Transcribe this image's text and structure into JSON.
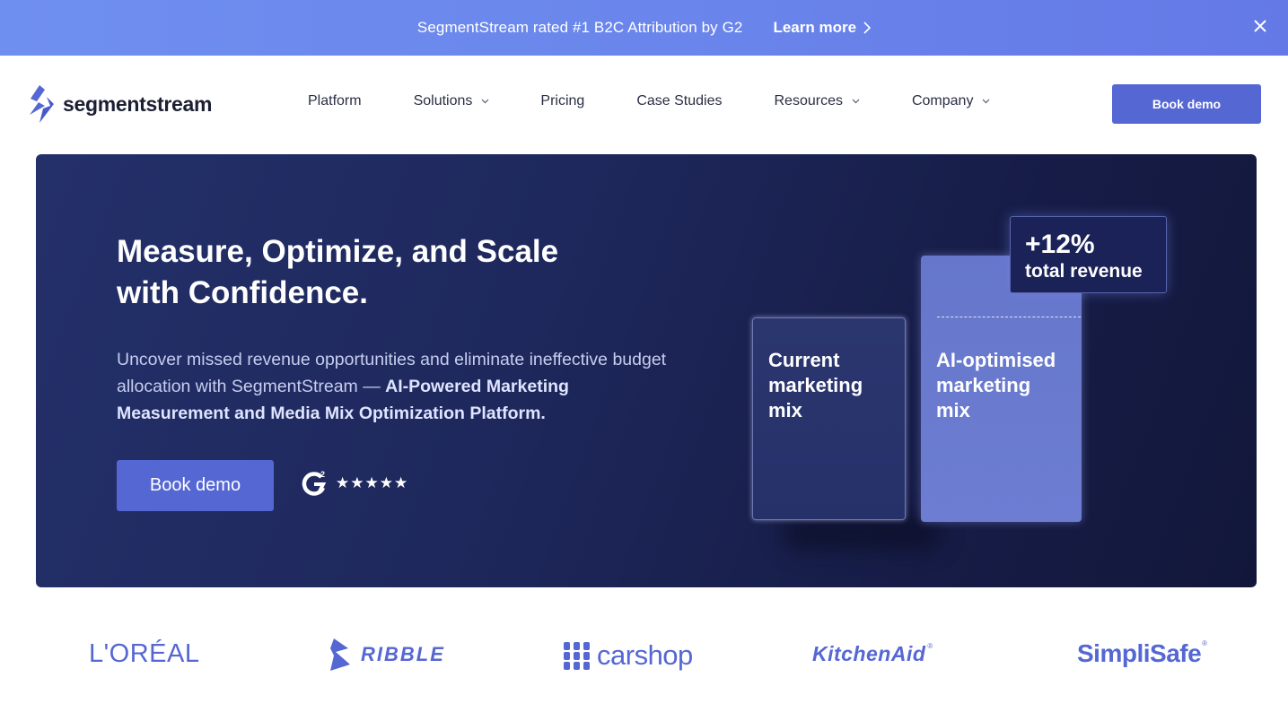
{
  "announcement": {
    "message": "SegmentStream rated #1 B2C Attribution by G2",
    "link_label": "Learn more"
  },
  "nav": {
    "brand": "segmentstream",
    "items": [
      {
        "label": "Platform",
        "dropdown": false
      },
      {
        "label": "Solutions",
        "dropdown": true
      },
      {
        "label": "Pricing",
        "dropdown": false
      },
      {
        "label": "Case Studies",
        "dropdown": false
      },
      {
        "label": "Resources",
        "dropdown": true
      },
      {
        "label": "Company",
        "dropdown": true
      }
    ],
    "cta_label": "Book demo"
  },
  "hero": {
    "title_line1": "Measure, Optimize, and Scale",
    "title_line2": "with Confidence.",
    "subtitle_plain": "Uncover missed revenue opportunities and eliminate ineffective budget allocation with SegmentStream — ",
    "subtitle_bold": "AI-Powered Marketing Measurement and Media Mix Optimization Platform.",
    "cta_label": "Book demo",
    "rating_stars": "★★★★★",
    "rating_icon": "g2-icon",
    "illustration": {
      "bar_current_line1": "Current",
      "bar_current_line2": "marketing",
      "bar_current_line3": "mix",
      "bar_ai_line1": "AI-optimised",
      "bar_ai_line2": "marketing",
      "bar_ai_line3": "mix",
      "badge_value": "+12%",
      "badge_text": "total revenue"
    }
  },
  "customers": [
    "L'ORÉAL",
    "RIBBLE",
    "carshop",
    "KitchenAid",
    "SimpliSafe"
  ],
  "colors": {
    "accent": "#5567d3",
    "banner": "#6a86ec",
    "hero_bg": "#1e285c"
  }
}
